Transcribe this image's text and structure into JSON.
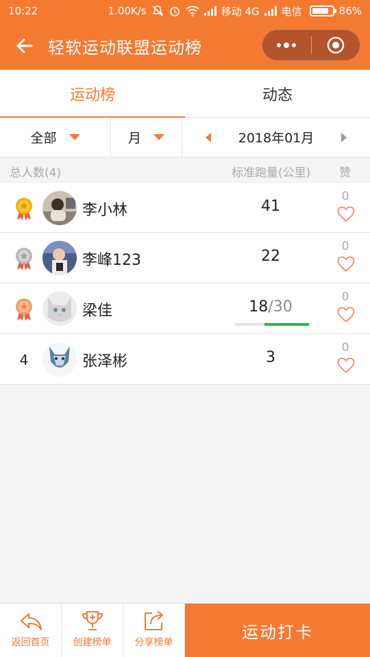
{
  "status_bar": {
    "time": "10:22",
    "net_speed": "1.00K/s",
    "carrier1": "移动 4G",
    "carrier2": "电信",
    "battery": "86%",
    "battery_level": 0.86
  },
  "title_bar": {
    "title": "轻软运动联盟运动榜",
    "back_icon": "arrow-left-icon",
    "more_icon": "more-dots-icon",
    "close_icon": "target-circle-icon"
  },
  "tabs": [
    {
      "label": "运动榜",
      "active": true
    },
    {
      "label": "动态",
      "active": false
    }
  ],
  "filters": {
    "scope": "全部",
    "period": "月",
    "month": "2018年01月"
  },
  "columns": {
    "total": "总人数(4)",
    "distance": "标准跑量(公里)",
    "likes": "赞"
  },
  "rows": [
    {
      "rank": "1",
      "medal": "gold",
      "name": "李小林",
      "distance": "41",
      "target": "",
      "likes": "0"
    },
    {
      "rank": "2",
      "medal": "silver",
      "name": "李峰123",
      "distance": "22",
      "target": "",
      "likes": "0"
    },
    {
      "rank": "3",
      "medal": "bronze",
      "name": "梁佳",
      "distance": "18",
      "target": "/30",
      "progress": 0.6,
      "likes": "0"
    },
    {
      "rank": "4",
      "medal": "",
      "name": "张泽彬",
      "distance": "3",
      "target": "",
      "likes": "0"
    }
  ],
  "bottom_bar": {
    "home": "返回首页",
    "create": "创建榜单",
    "share": "分享榜单",
    "checkin": "运动打卡"
  },
  "colors": {
    "accent": "#f47a32",
    "progress": "#2fb34a",
    "gold": "#f0b400",
    "silver": "#b8b8b8",
    "bronze": "#f2a06a"
  }
}
